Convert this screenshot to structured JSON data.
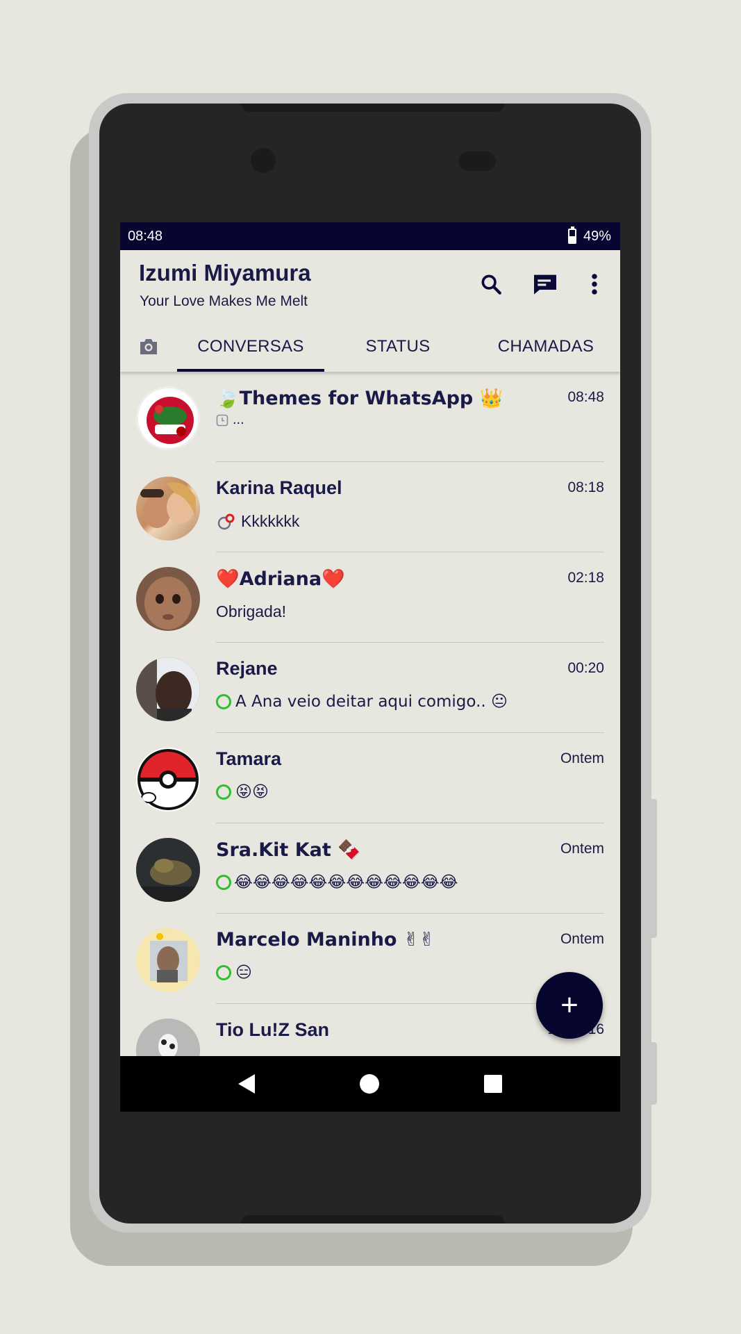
{
  "status_bar": {
    "time": "08:48",
    "battery": "49%",
    "battery_level": 0.49
  },
  "header": {
    "title": "Izumi Miyamura",
    "subtitle": "Your Love Makes Me Melt"
  },
  "icons": {
    "search": "search-icon",
    "new_chat": "chat-icon",
    "more": "more-vert-icon",
    "camera": "camera-icon"
  },
  "tabs": [
    {
      "label": "CONVERSAS",
      "active": true
    },
    {
      "label": "STATUS",
      "active": false
    },
    {
      "label": "CHAMADAS",
      "active": false
    }
  ],
  "chats": [
    {
      "name": "🍃Themes for WhatsApp 👑",
      "time": "08:48",
      "message": "...",
      "indicator": "clock"
    },
    {
      "name": "Karina Raquel",
      "time": "08:18",
      "message": "Kkkkkkk",
      "indicator": "status-pin"
    },
    {
      "name": "❤️Adriana❤️",
      "time": "02:18",
      "message": "Obrigada!",
      "indicator": "none"
    },
    {
      "name": "Rejane",
      "time": "00:20",
      "message": "A Ana veio deitar aqui comigo.. 😐",
      "indicator": "status-ring"
    },
    {
      "name": "Tamara",
      "time": "Ontem",
      "message": "😝😝",
      "indicator": "status-ring"
    },
    {
      "name": "Sra.Kit Kat 🍫",
      "time": "Ontem",
      "message": "😂😂😂😂😂😂😂😂😂😂😂😂",
      "indicator": "status-ring"
    },
    {
      "name": "Marcelo Maninho ✌✌",
      "time": "Ontem",
      "message": "😑",
      "indicator": "status-ring"
    },
    {
      "name": "Tio Lu!Z San",
      "time": "12/12/16",
      "message": "",
      "indicator": "none"
    }
  ],
  "fab": {
    "label": "+"
  },
  "colors": {
    "primary_dark": "#060630",
    "text": "#1a1a48",
    "background": "#e7e6df",
    "status_ring": "#2fbe2f"
  }
}
